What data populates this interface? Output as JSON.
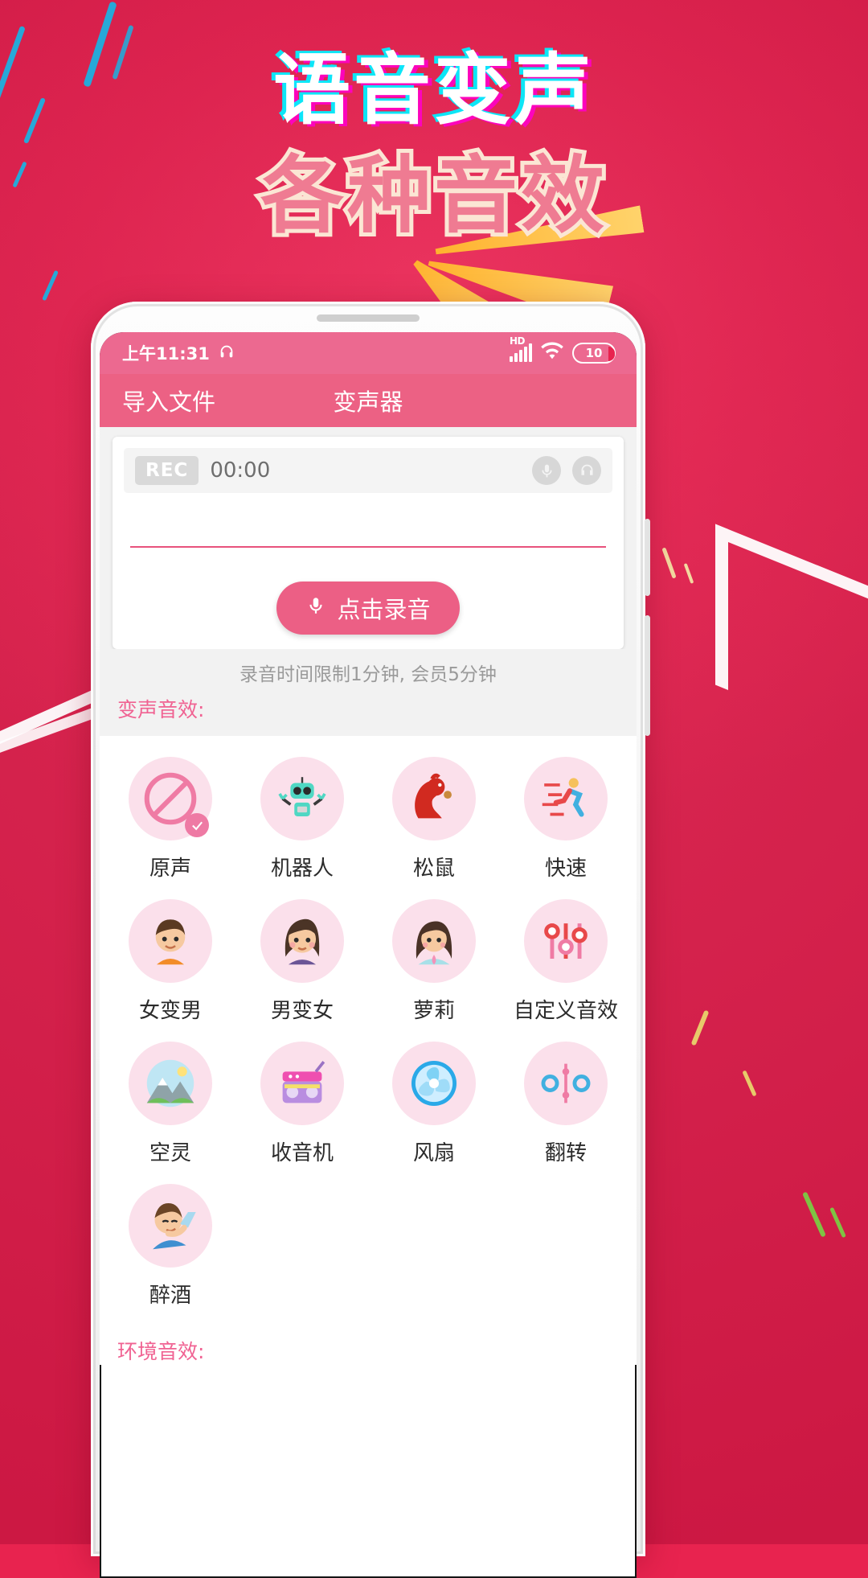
{
  "promo": {
    "title_line1": "语音变声",
    "title_line2": "各种音效"
  },
  "statusbar": {
    "time": "上午11:31",
    "headphone_icon": "headphone-icon",
    "network_label": "HD",
    "wifi_icon": "wifi-icon",
    "battery_level": "10"
  },
  "appbar": {
    "import_label": "导入文件",
    "title": "变声器"
  },
  "recorder": {
    "rec_badge": "REC",
    "timer": "00:00",
    "mic_toggle_icon": "microphone-icon",
    "headphone_toggle_icon": "headphone-icon",
    "record_button_label": "点击录音",
    "record_button_icon": "microphone-icon",
    "limit_note": "录音时间限制1分钟, 会员5分钟"
  },
  "sections": {
    "voice_effects_label": "变声音效:",
    "ambient_effects_label": "环境音效:"
  },
  "voice_effects": [
    {
      "label": "原声",
      "icon": "no-effect-icon",
      "selected": true
    },
    {
      "label": "机器人",
      "icon": "robot-icon",
      "selected": false
    },
    {
      "label": "松鼠",
      "icon": "squirrel-icon",
      "selected": false
    },
    {
      "label": "快速",
      "icon": "runner-icon",
      "selected": false
    },
    {
      "label": "女变男",
      "icon": "man-face-icon",
      "selected": false
    },
    {
      "label": "男变女",
      "icon": "woman-face-icon",
      "selected": false
    },
    {
      "label": "萝莉",
      "icon": "girl-face-icon",
      "selected": false
    },
    {
      "label": "自定义音效",
      "icon": "equalizer-icon",
      "selected": false
    },
    {
      "label": "空灵",
      "icon": "mountain-icon",
      "selected": false
    },
    {
      "label": "收音机",
      "icon": "radio-icon",
      "selected": false
    },
    {
      "label": "风扇",
      "icon": "fan-icon",
      "selected": false
    },
    {
      "label": "翻转",
      "icon": "reverse-icon",
      "selected": false
    },
    {
      "label": "醉酒",
      "icon": "drunk-icon",
      "selected": false
    }
  ],
  "colors": {
    "background_red": "#e8234f",
    "header_pink": "#ec6184",
    "accent_pink": "#ec5f85",
    "label_pink": "#f06292",
    "avatar_bg": "#fbe0eb"
  }
}
